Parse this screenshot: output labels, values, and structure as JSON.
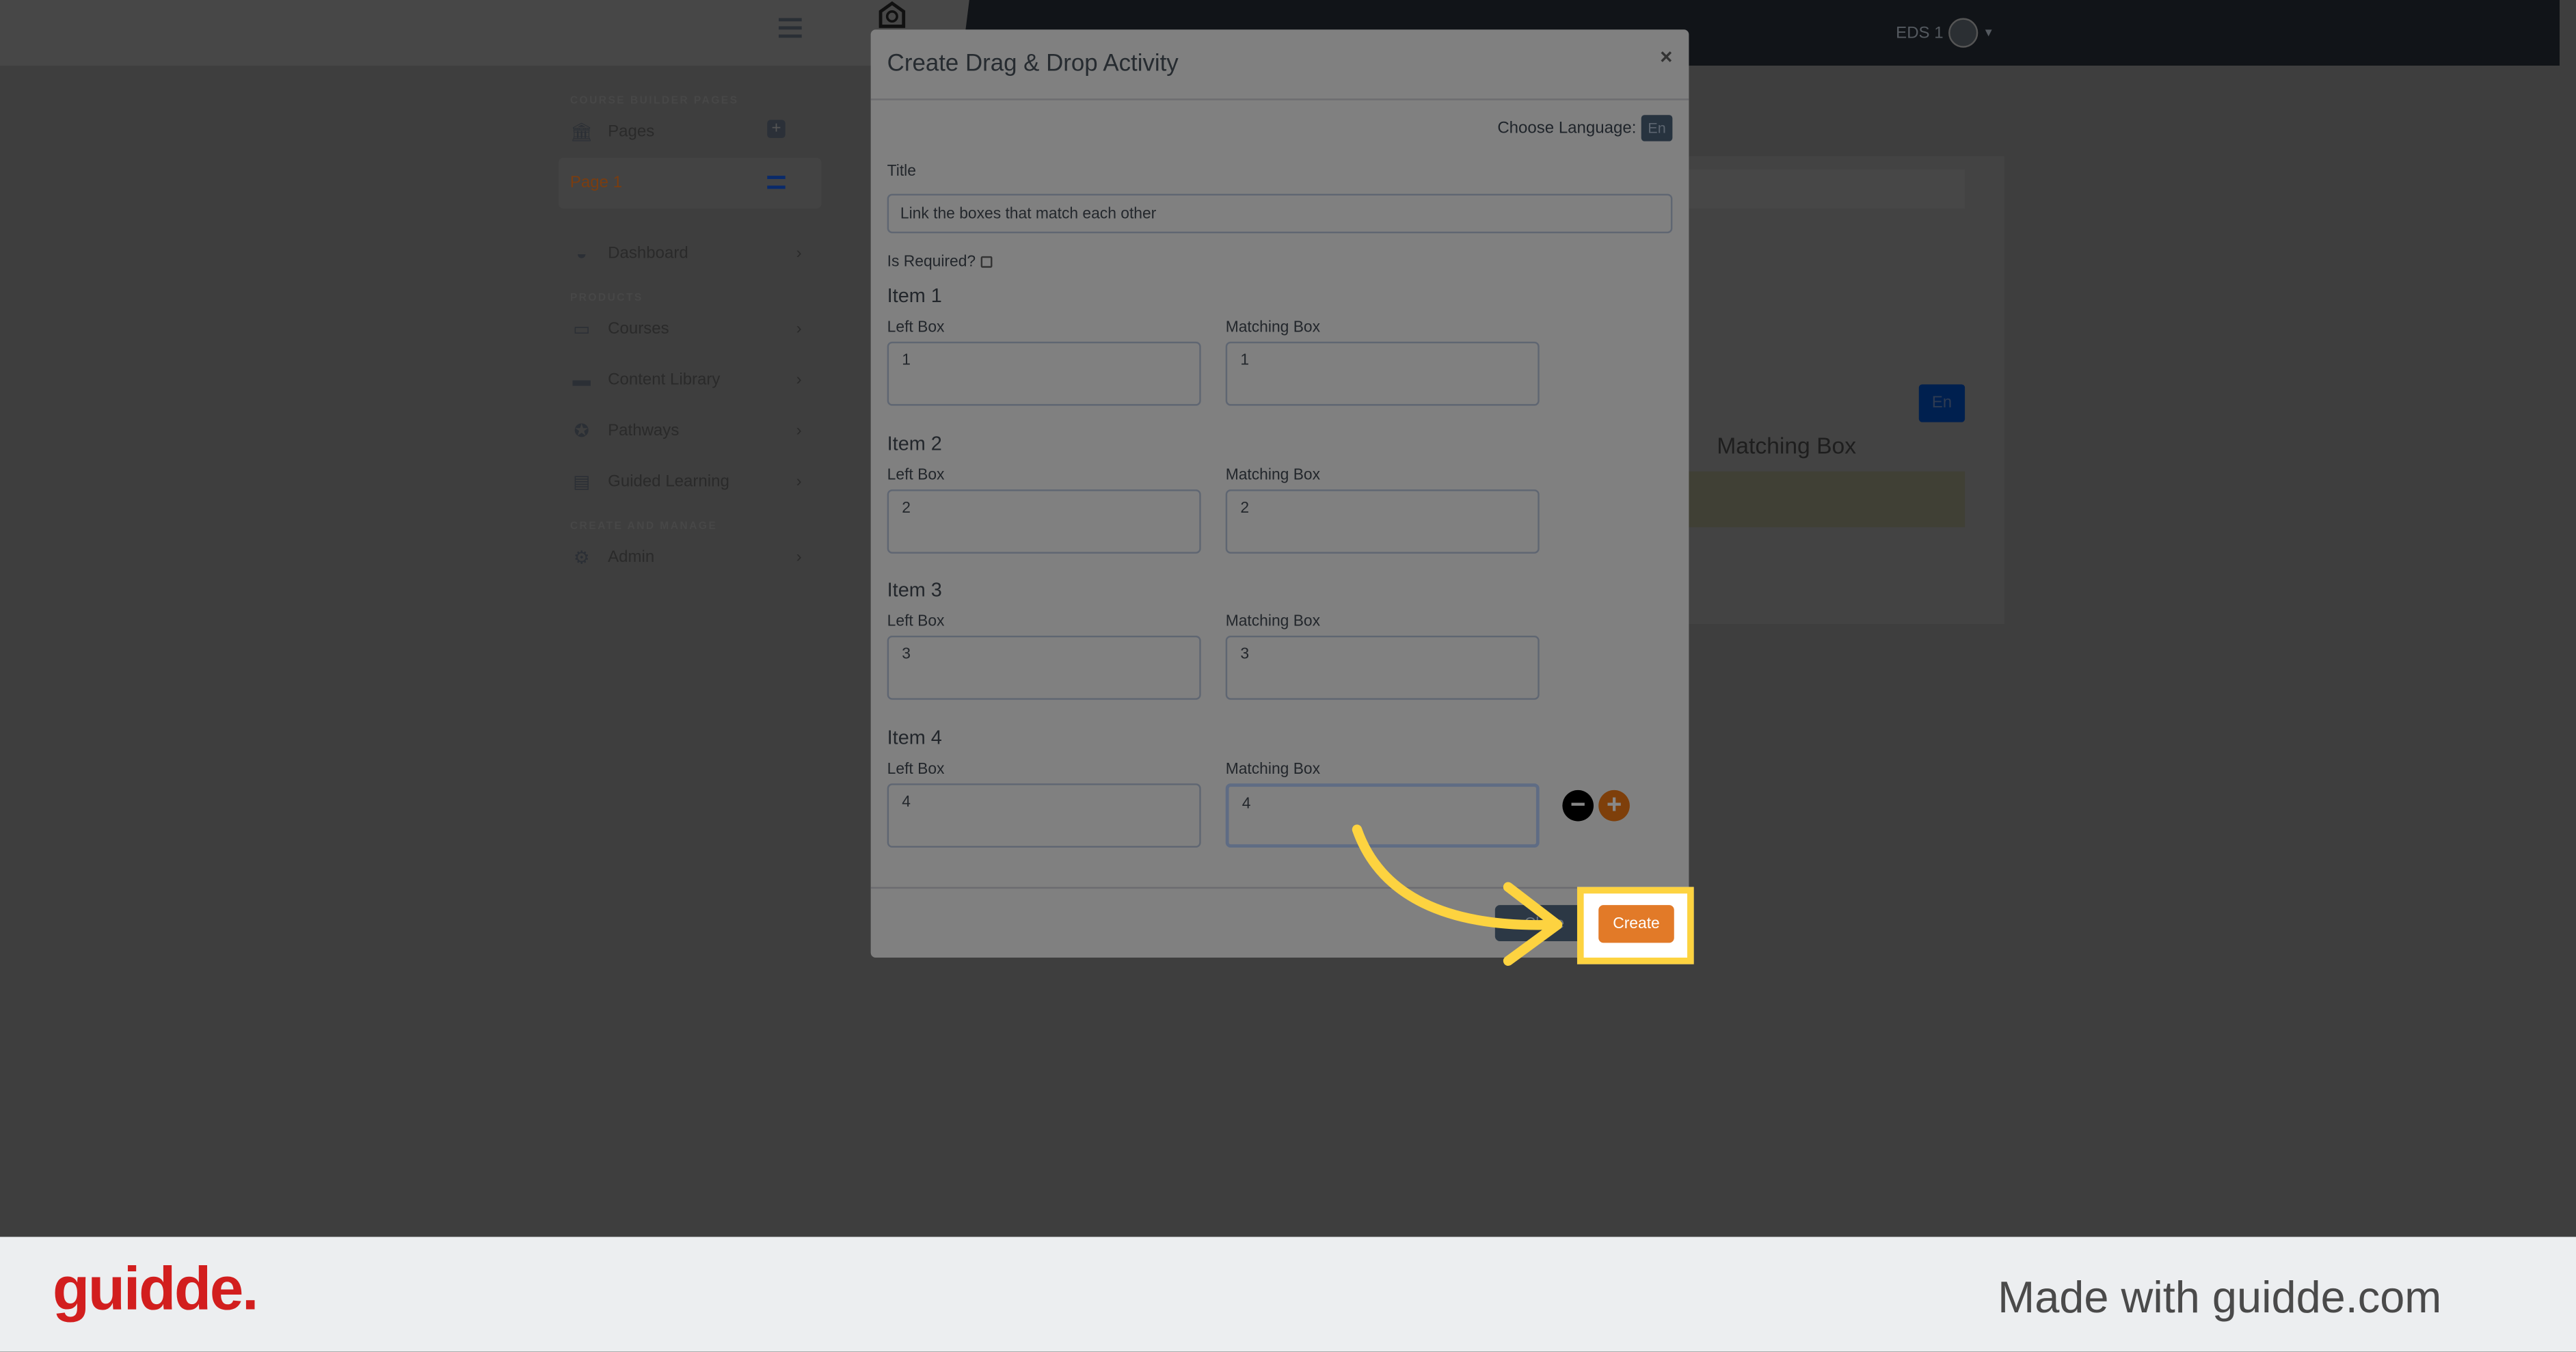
{
  "header": {
    "user_name": "EDS 1",
    "icons": [
      "menu-icon",
      "logo-icon",
      "user-avatar-icon",
      "caret-down-icon"
    ]
  },
  "sidebar": {
    "sections": [
      "COURSE BUILDER PAGES",
      "PRODUCTS",
      "CREATE AND MANAGE"
    ],
    "pages_label": "Pages",
    "page1_label": "Page 1",
    "items": [
      {
        "label": "Dashboard",
        "icon": "dashboard-icon"
      },
      {
        "label": "Courses",
        "icon": "courses-icon"
      },
      {
        "label": "Content Library",
        "icon": "book-icon"
      },
      {
        "label": "Pathways",
        "icon": "award-icon"
      },
      {
        "label": "Guided Learning",
        "icon": "clipboard-icon"
      },
      {
        "label": "Admin",
        "icon": "gear-icon"
      }
    ]
  },
  "background": {
    "lang": "En",
    "matching_box": "Matching Box"
  },
  "modal": {
    "title": "Create Drag & Drop Activity",
    "close": "×",
    "choose_language": "Choose Language:",
    "lang": "En",
    "title_label": "Title",
    "title_value": "Link the boxes that match each other",
    "is_required": "Is Required?",
    "is_required_checked": false,
    "left_label": "Left Box",
    "match_label": "Matching Box",
    "items": [
      {
        "heading": "Item 1",
        "left": "1",
        "match": "1"
      },
      {
        "heading": "Item 2",
        "left": "2",
        "match": "2"
      },
      {
        "heading": "Item 3",
        "left": "3",
        "match": "3"
      },
      {
        "heading": "Item 4",
        "left": "4",
        "match": "4"
      }
    ],
    "close_button": "Close",
    "create_button": "Create"
  },
  "colors": {
    "accent": "#e27a28",
    "highlight": "#fdd340",
    "navbar": "#111418",
    "brand": "#d21e1e"
  },
  "footer": {
    "logo": "guidde.",
    "made_with": "Made with guidde.com"
  }
}
